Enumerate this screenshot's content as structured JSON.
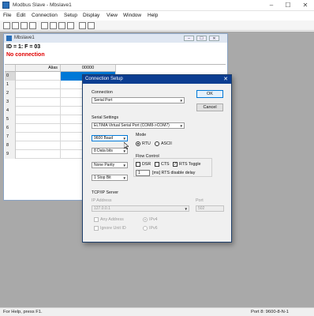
{
  "app": {
    "title": "Modbus Slave - Mbslave1",
    "menu": [
      "File",
      "Edit",
      "Connection",
      "Setup",
      "Display",
      "View",
      "Window",
      "Help"
    ],
    "window_controls": {
      "minimize": "–",
      "maximize": "☐",
      "close": "✕"
    }
  },
  "child": {
    "title": "Mbslave1",
    "id_line": "ID = 1: F = 03",
    "status": "No connection",
    "controls": {
      "minimize": "–",
      "maximize": "☐",
      "close": "✕"
    },
    "grid": {
      "headers": [
        "",
        "Alias",
        "00000"
      ],
      "rows": [
        "0",
        "1",
        "2",
        "3",
        "4",
        "5",
        "6",
        "7",
        "8",
        "9"
      ],
      "selected_row": 0
    }
  },
  "dialog": {
    "title": "Connection Setup",
    "close": "✕",
    "connection_label": "Connection",
    "connection_value": "Serial Port",
    "ok_label": "OK",
    "cancel_label": "Cancel",
    "serial_settings_label": "Serial Settings",
    "port_value": "ELTIMA Virtual Serial Port (COM8->COM7)",
    "baud_value": "9600 Baud",
    "data_bits_value": "8 Data bits",
    "parity_value": "None Parity",
    "stop_bits_value": "1 Stop Bit",
    "mode_label": "Mode",
    "mode_rtu": "RTU",
    "mode_ascii": "ASCII",
    "flow_label": "Flow Control",
    "flow_dsr": "DSR",
    "flow_cts": "CTS",
    "flow_rts": "RTS Toggle",
    "rts_delay_value": "1",
    "rts_delay_label": "[ms] RTS disable delay",
    "tcpip_label": "TCP/IP Server",
    "ip_label": "IP Address",
    "ip_value": "127.0.0.1",
    "port_label": "Port",
    "port_num_value": "502",
    "any_address": "Any Address",
    "ignore_unit_id": "Ignore Unit ID",
    "ipv4": "IPv4",
    "ipv6": "IPv6"
  },
  "status": {
    "help": "For Help, press F1.",
    "port": "Port 8: 9600-8-N-1"
  }
}
